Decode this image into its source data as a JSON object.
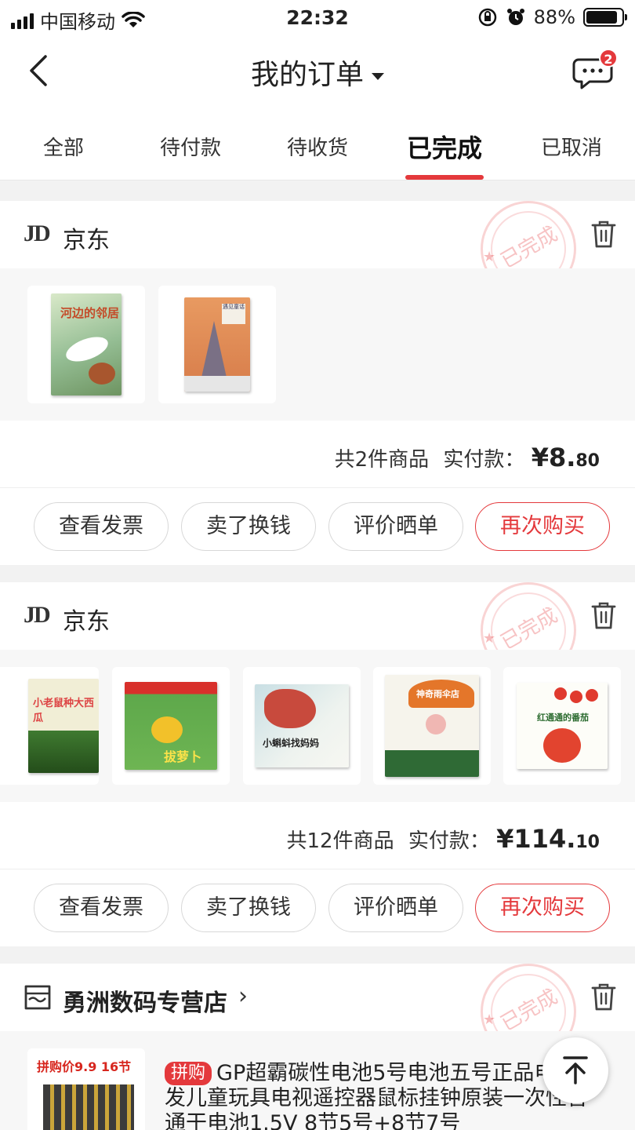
{
  "status_bar": {
    "carrier": "中国移动",
    "time": "22:32",
    "battery": "88%",
    "battery_level": 0.88
  },
  "header": {
    "title": "我的订单",
    "message_badge": "2"
  },
  "tabs": [
    {
      "label": "全部",
      "active": false
    },
    {
      "label": "待付款",
      "active": false
    },
    {
      "label": "待收货",
      "active": false
    },
    {
      "label": "已完成",
      "active": true
    },
    {
      "label": "已取消",
      "active": false
    }
  ],
  "orders": [
    {
      "shop_logo": "JD",
      "shop_name": "京东",
      "stamp": "已完成",
      "summary_count": "共2件商品",
      "summary_paid": "实付款：",
      "price_main": "¥8.",
      "price_cents": "80",
      "products": [
        {
          "cover_text": "河边的邻居",
          "color": "#7fae8e"
        },
        {
          "cover_text": "遇见童话",
          "color": "#e8965a"
        }
      ]
    },
    {
      "shop_logo": "JD",
      "shop_name": "京东",
      "stamp": "已完成",
      "summary_count": "共12件商品",
      "summary_paid": "实付款：",
      "price_main": "¥114.",
      "price_cents": "10",
      "products": [
        {
          "cover_text": "小老鼠种大西瓜",
          "color": "#4b8a3b"
        },
        {
          "cover_text": "拔萝卜",
          "color": "#d9352f"
        },
        {
          "cover_text": "小蝌蚪找妈妈",
          "color": "#c8483c"
        },
        {
          "cover_text": "神奇雨伞店",
          "color": "#e3792d"
        },
        {
          "cover_text": "红通通的番茄",
          "color": "#e0513f"
        }
      ]
    },
    {
      "shop_name": "勇洲数码专营店",
      "stamp": "已完成",
      "promo": "拼购价9.9  16节",
      "tag": "拼购",
      "product_title": "GP超霸碳性电池5号电池五号正品电池批发儿童玩具电视遥控器鼠标挂钟原装一次性普通干电池1.5V 8节5号+8节7号"
    }
  ],
  "buttons": {
    "invoice": "查看发票",
    "sell": "卖了换钱",
    "review": "评价晒单",
    "rebuy": "再次购买"
  },
  "colors": {
    "accent": "#e4393c",
    "background": "#f2f2f2"
  }
}
